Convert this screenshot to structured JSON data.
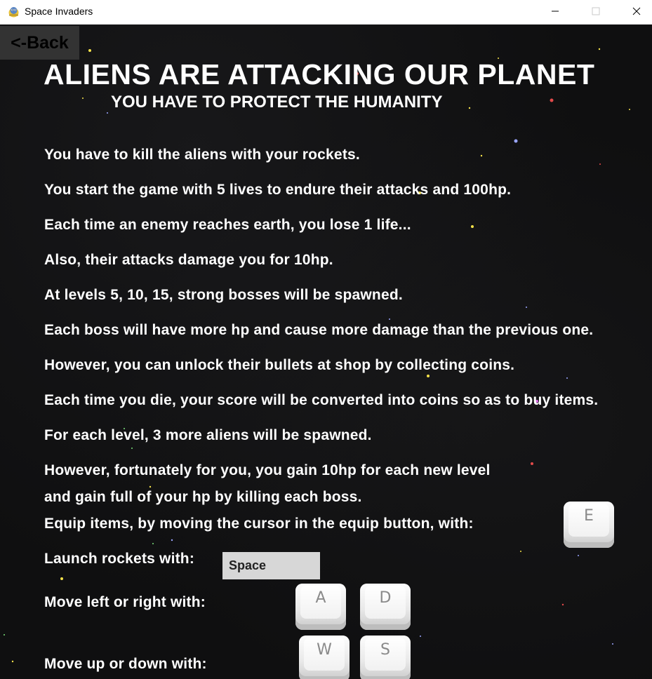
{
  "window": {
    "title": "Space Invaders"
  },
  "back_button": {
    "label": "<-Back"
  },
  "headline": "ALIENS ARE ATTACKING OUR PLANET",
  "subheadline": "YOU HAVE TO PROTECT THE HUMANITY",
  "instructions": [
    "You have to kill the aliens with your rockets.",
    "You start the game with 5 lives to endure their attacks and 100hp.",
    "Each time an enemy reaches earth, you lose 1 life...",
    "Also, their attacks damage you for 10hp.",
    "At levels 5, 10, 15, strong bosses will be spawned.",
    "Each boss will have more hp and cause more damage than the previous one.",
    "However, you can unlock their bullets at shop by collecting coins.",
    "Each time you die, your score will be converted into coins so as to buy items.",
    "For each level, 3 more aliens will be spawned.",
    "However, fortunately for you, you gain 10hp for each new level",
    "and gain full of your hp by killing each boss."
  ],
  "controls": {
    "equip_label": "Equip items, by moving the cursor in the equip button, with:",
    "equip_key": "E",
    "launch_label": "Launch rockets with:",
    "launch_key": "Space",
    "move_lr_label": "Move left or right with:",
    "left_key": "A",
    "right_key": "D",
    "move_ud_label": "Move up  or down with:",
    "up_key": "W",
    "down_key": "S"
  },
  "colors": {
    "background": "#0f0f10",
    "text": "#ffffff",
    "back_button_bg": "#333333",
    "space_key_bg": "#d7d7d7"
  }
}
